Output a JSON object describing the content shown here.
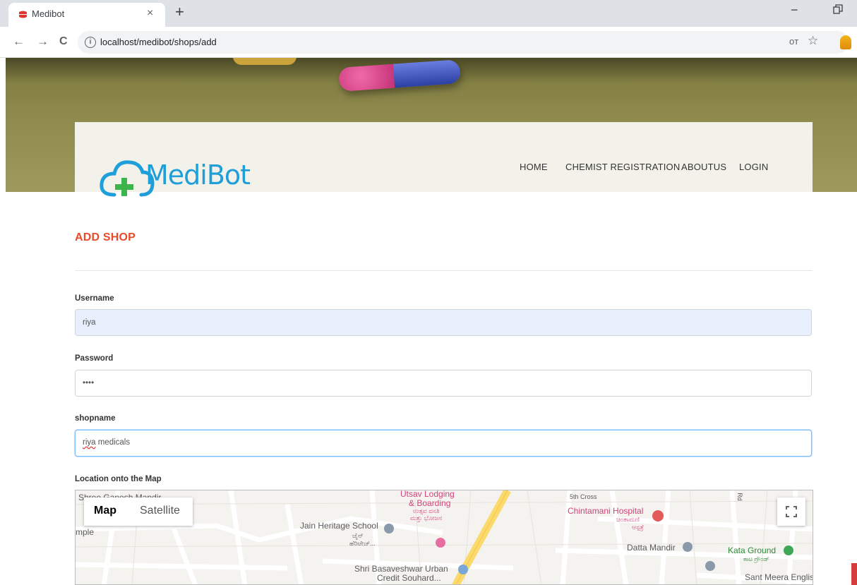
{
  "browser": {
    "tab_title": "Medibot",
    "tab_close": "×",
    "new_tab": "+",
    "minimize": "−",
    "url": "localhost/medibot/shops/add",
    "back": "←",
    "forward": "→",
    "reload": "C",
    "info": "i",
    "key": "oᴛ",
    "star": "☆"
  },
  "site": {
    "logo_text_a": "Medi",
    "logo_text_b": "Bot",
    "nav": [
      "HOME",
      "CHEMIST REGISTRATION",
      "ABOUTUS",
      "LOGIN"
    ]
  },
  "form": {
    "title": "ADD SHOP",
    "username_label": "Username",
    "username_value": "riya",
    "password_label": "Password",
    "password_value": "••••",
    "shopname_label": "shopname",
    "shopname_value_a": "riya",
    "shopname_value_b": " medicals",
    "location_label": "Location onto the Map"
  },
  "map": {
    "map_button": "Map",
    "satellite_button": "Satellite",
    "labels": {
      "shree_ganesh": "Shree Ganesh Mandir",
      "temple": "mple",
      "utsav_1": "Utsav Lodging",
      "utsav_2": "& Boarding",
      "utsav_kn1": "ಉತ್ಸವ ವಸತಿ",
      "utsav_kn2": "ಮತ್ತು ಭೋಜನ",
      "jain": "Jain Heritage School",
      "jain_kn1": "ಜೈನ್",
      "jain_kn2": "ಹೆರಿಟೇಜ್...",
      "basaveshwar_1": "Shri Basaveshwar Urban",
      "basaveshwar_2": "Credit Souhard...",
      "fifth_cross": "5th Cross",
      "chintamani": "Chintamani Hospital",
      "chintamani_kn1": "ಚಿಂತಾಮಣಿ",
      "chintamani_kn2": "ಆಸ್ಪತ್ರೆ",
      "datta": "Datta Mandir",
      "kata": "Kata Ground",
      "kata_kn": "ಕಾಟ ಗ್ರೌಂಡ್",
      "sant_meera": "Sant Meera Englis",
      "rd": "Rd"
    }
  },
  "colors": {
    "accent": "#ea4a2c",
    "logo_blue": "#1e9fd9",
    "logo_green": "#3cb54a",
    "autofill": "#e8f0fe",
    "focus": "#80bdff"
  }
}
